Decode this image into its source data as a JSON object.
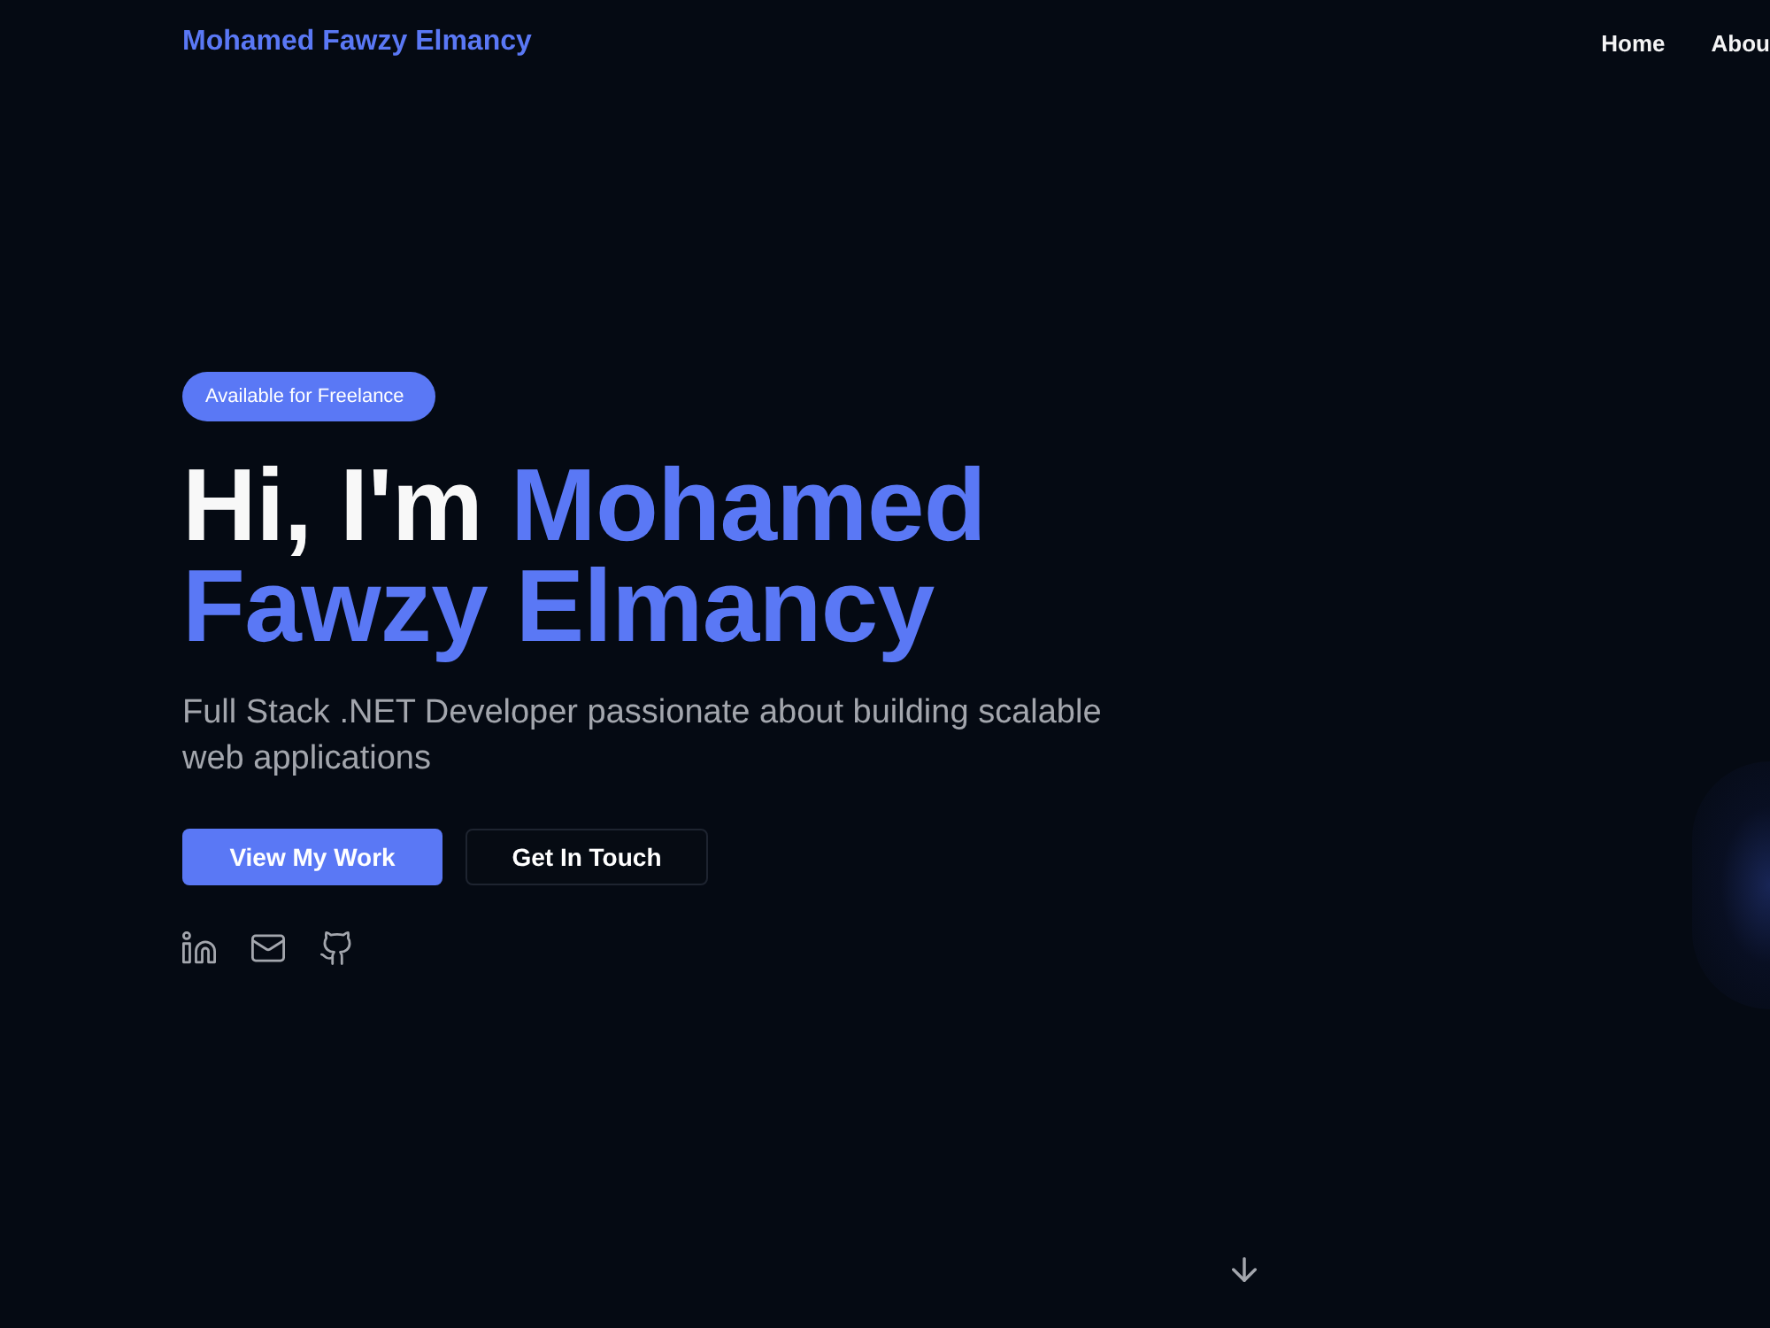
{
  "header": {
    "logo": "Mohamed Fawzy Elmancy",
    "nav": [
      {
        "label": "Home"
      },
      {
        "label": "Abou"
      }
    ]
  },
  "hero": {
    "badge": "Available for Freelance",
    "heading": {
      "greeting": "Hi, I'm",
      "name": "Mohamed Fawzy Elmancy"
    },
    "subtitle": "Full Stack .NET Developer passionate about building scalable web applications",
    "buttons": [
      {
        "label": "View My Work",
        "kind": "primary"
      },
      {
        "label": "Get In Touch",
        "kind": "outline"
      }
    ],
    "social": [
      {
        "kind": "linkedin"
      },
      {
        "kind": "email"
      },
      {
        "kind": "github"
      }
    ]
  }
}
